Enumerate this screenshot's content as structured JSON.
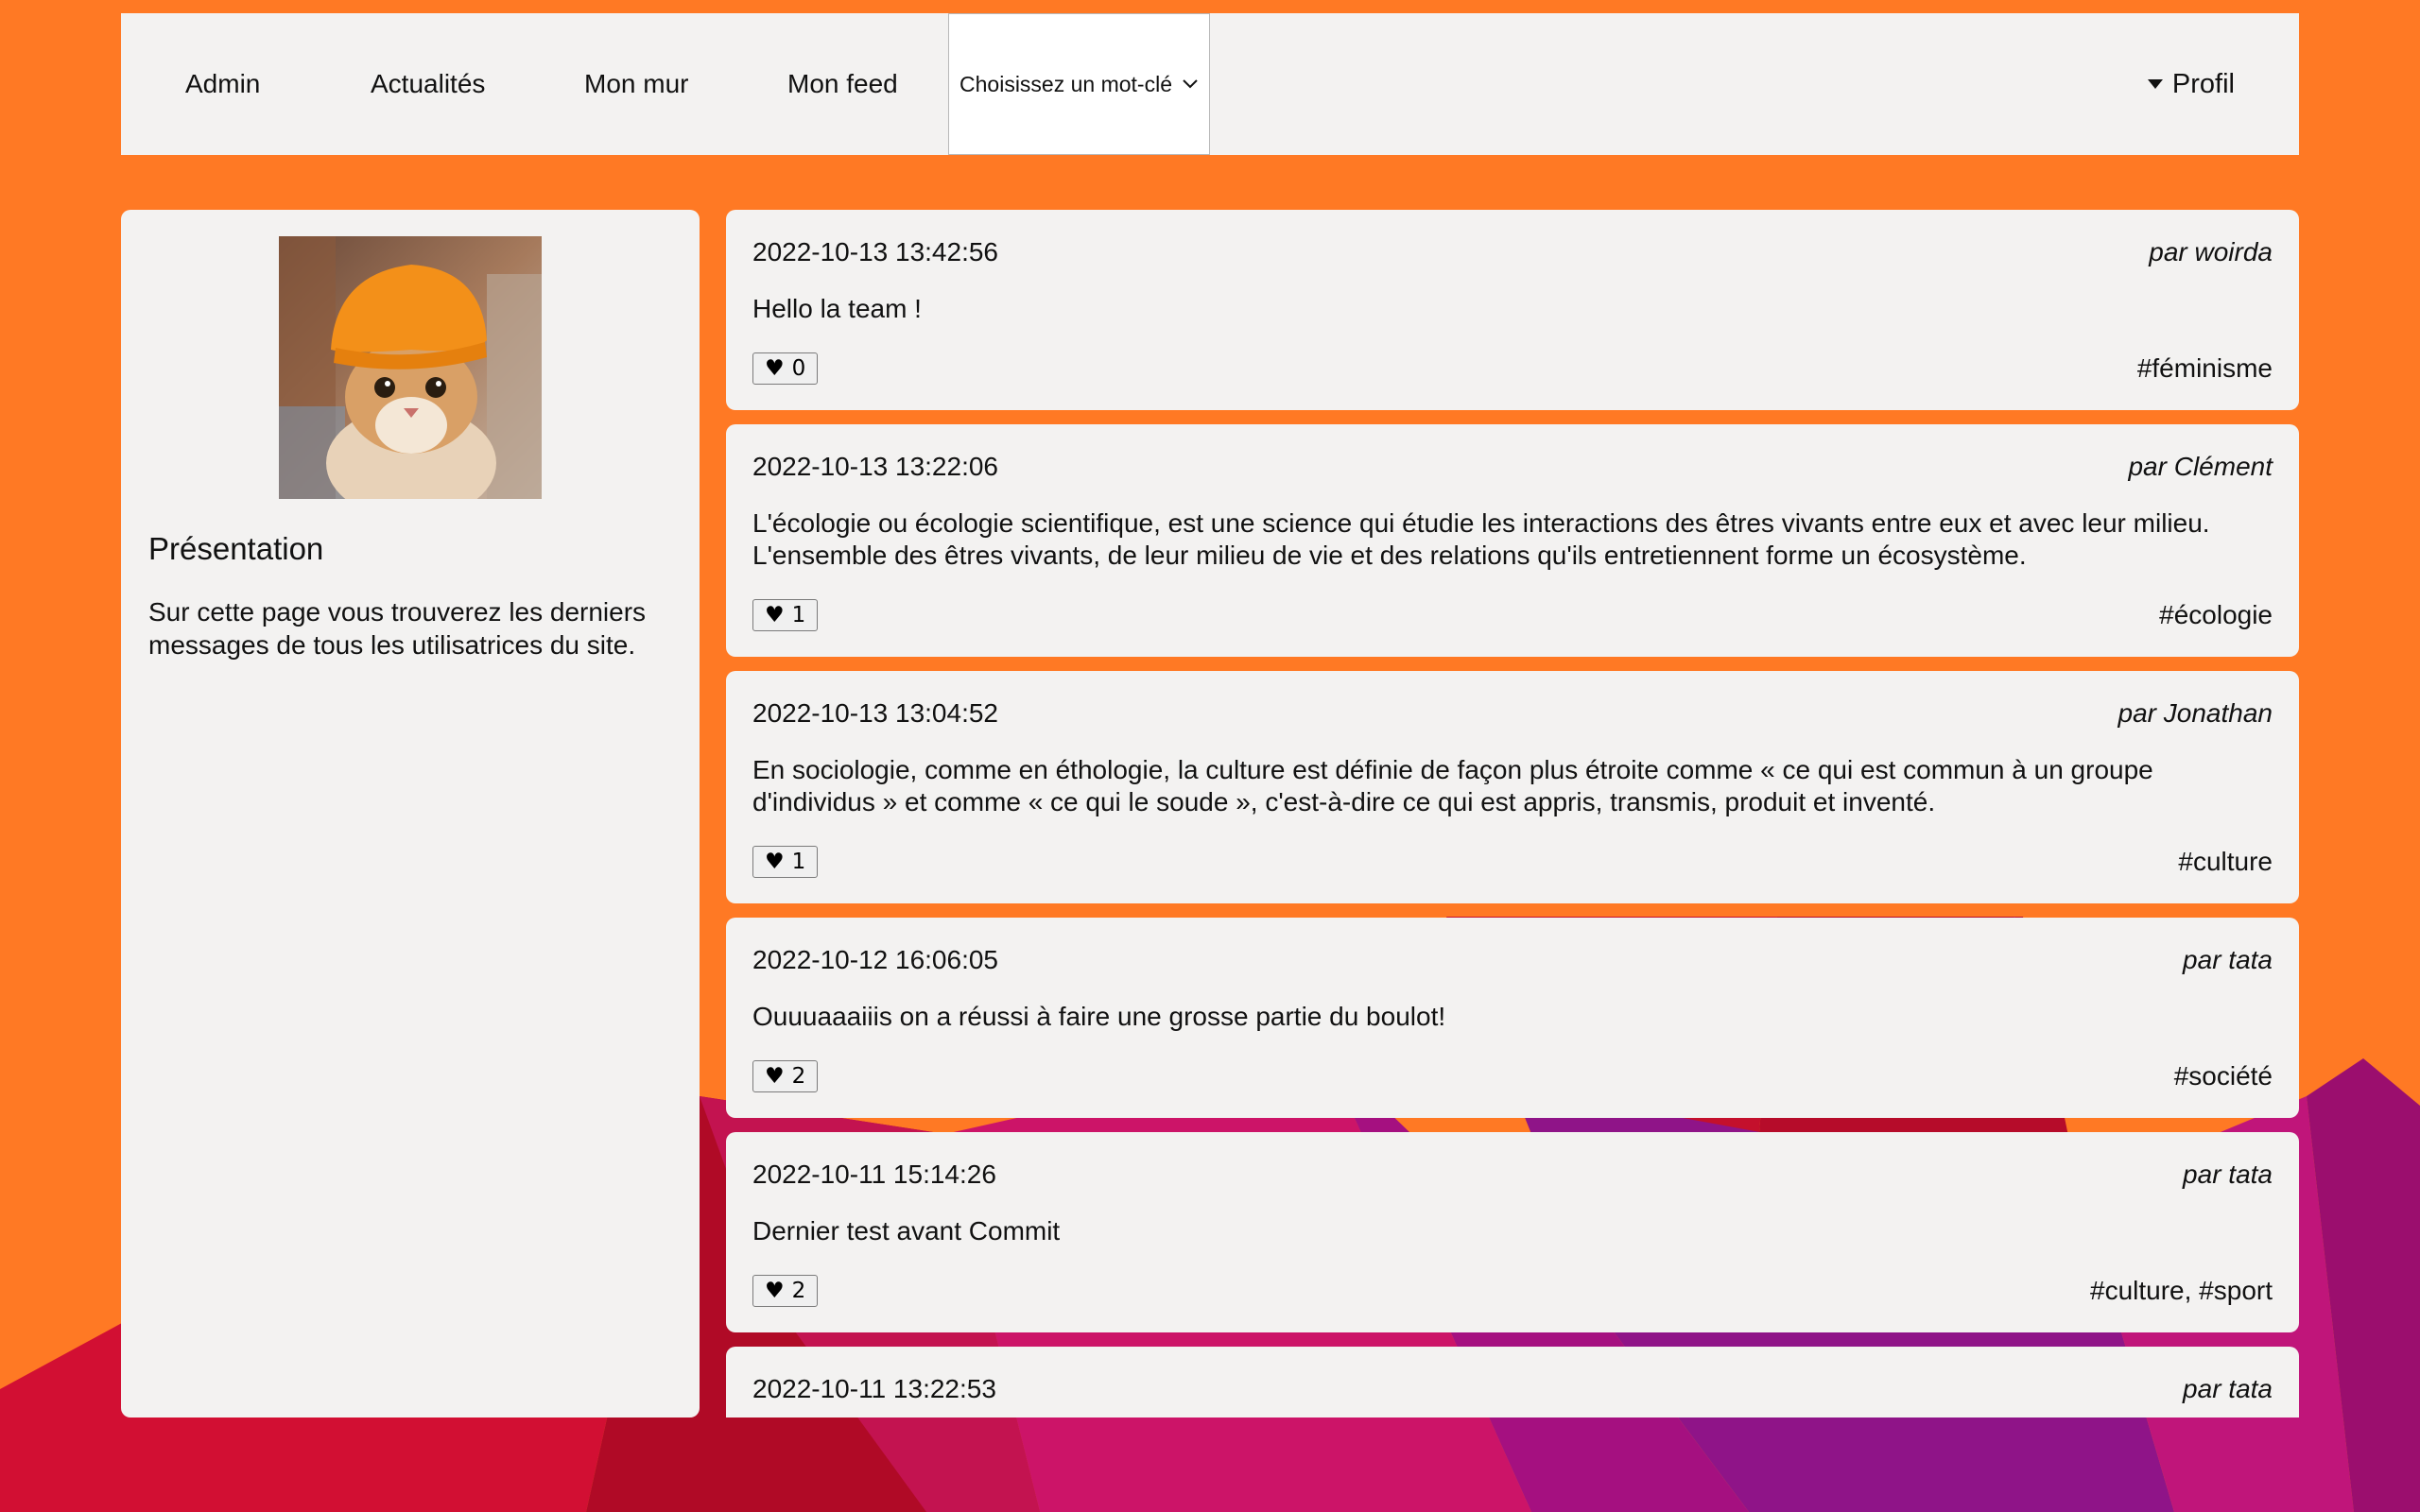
{
  "nav": {
    "items": [
      "Admin",
      "Actualités",
      "Mon mur",
      "Mon feed"
    ],
    "dropdown_label": "Choisissez un mot-clé",
    "profile_label": "Profil"
  },
  "sidebar": {
    "avatar_icon": "cat-avatar-icon",
    "title": "Présentation",
    "text": "Sur cette page vous trouverez les derniers messages de tous les utilisatrices du site."
  },
  "posts": [
    {
      "date": "2022-10-13 13:42:56",
      "author": "par woirda",
      "body": "Hello la team !",
      "likes": "0",
      "tags": "#féminisme"
    },
    {
      "date": "2022-10-13 13:22:06",
      "author": "par Clément",
      "body": "L'écologie ou écologie scientifique, est une science qui étudie les interactions des êtres vivants entre eux et avec leur milieu. L'ensemble des êtres vivants, de leur milieu de vie et des relations qu'ils entretiennent forme un écosystème.",
      "likes": "1",
      "tags": "#écologie"
    },
    {
      "date": "2022-10-13 13:04:52",
      "author": "par Jonathan",
      "body": "En sociologie, comme en éthologie, la culture est définie de façon plus étroite comme « ce qui est commun à un groupe d'individus » et comme « ce qui le soude », c'est-à-dire ce qui est appris, transmis, produit et inventé.",
      "likes": "1",
      "tags": "#culture"
    },
    {
      "date": "2022-10-12 16:06:05",
      "author": "par tata",
      "body": "Ouuuaaaiiis on a réussi à faire une grosse partie du boulot!",
      "likes": "2",
      "tags": "#société"
    },
    {
      "date": "2022-10-11 15:14:26",
      "author": "par tata",
      "body": "Dernier test avant Commit",
      "likes": "2",
      "tags": "#culture, #sport"
    },
    {
      "date": "2022-10-11 13:22:53",
      "author": "par tata",
      "body": "",
      "likes": "",
      "tags": ""
    }
  ],
  "colors": {
    "background": "#ff7924",
    "panel": "#f3f2f1"
  }
}
